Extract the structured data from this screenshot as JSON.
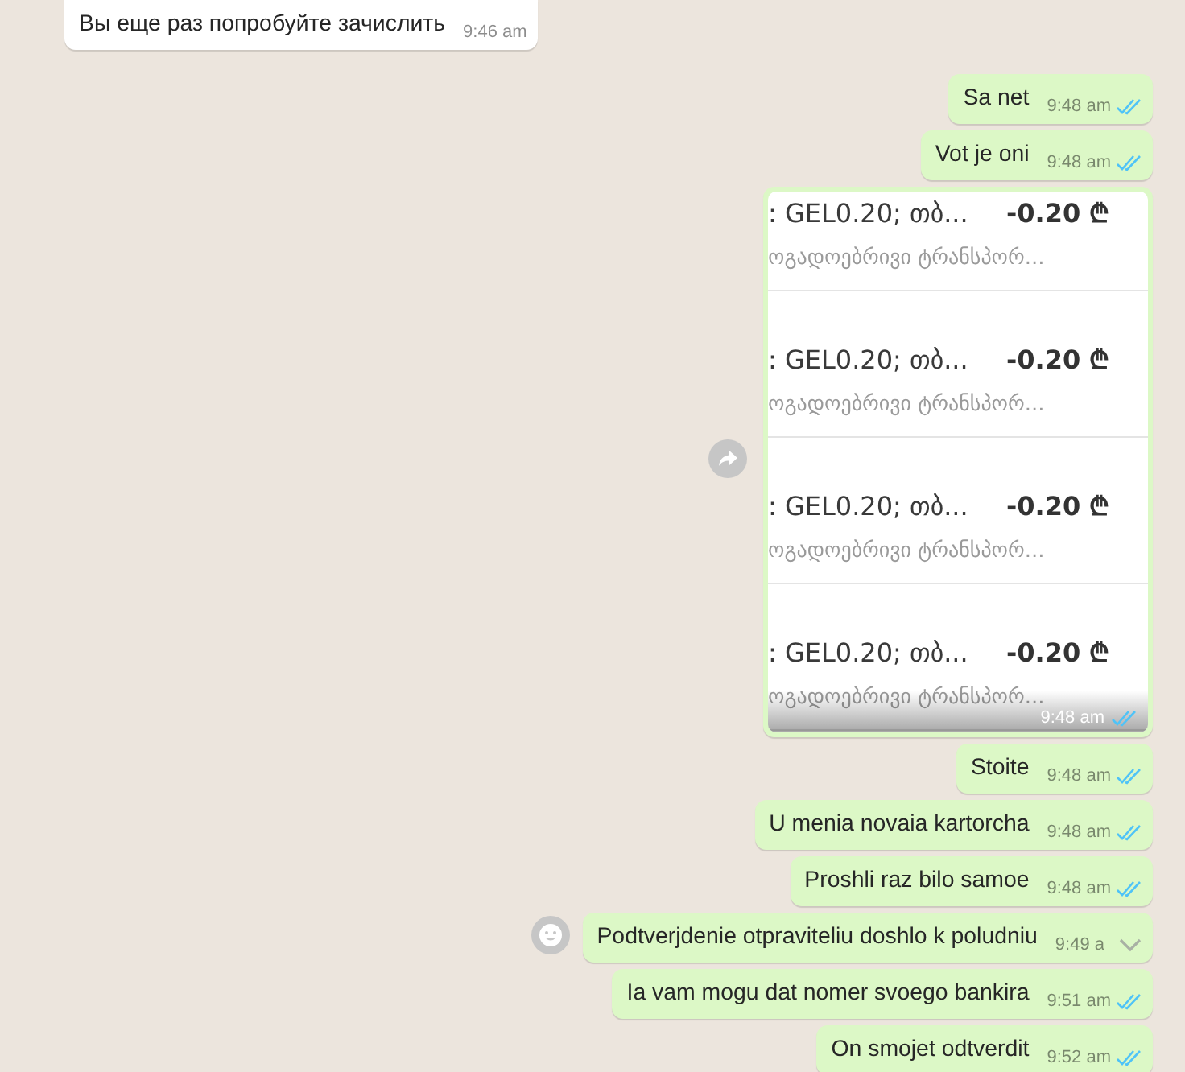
{
  "messages": [
    {
      "kind": "text",
      "outgoing": false,
      "text": "Вы еще раз попробуйте зачислить",
      "time": "9:46 am",
      "hovered": false
    },
    {
      "kind": "text",
      "outgoing": true,
      "text": "Sa net",
      "time": "9:48 am",
      "read": true,
      "hovered": false
    },
    {
      "kind": "text",
      "outgoing": true,
      "text": "Vot je oni",
      "time": "9:48 am",
      "read": true,
      "hovered": false
    },
    {
      "kind": "image",
      "outgoing": true,
      "time": "9:48 am",
      "read": true,
      "transactions": [
        {
          "title": ": GEL0.20; თბ...",
          "amount": "-0.20 ₾",
          "subtitle": "ოგადოებრივი ტრანსპორ..."
        },
        {
          "title": ": GEL0.20; თბ...",
          "amount": "-0.20 ₾",
          "subtitle": "ოგადოებრივი ტრანსპორ..."
        },
        {
          "title": ": GEL0.20; თბ...",
          "amount": "-0.20 ₾",
          "subtitle": "ოგადოებრივი ტრანსპორ..."
        },
        {
          "title": ": GEL0.20; თბ...",
          "amount": "-0.20 ₾",
          "subtitle": "ოგადოებრივი ტრანსპორ..."
        }
      ]
    },
    {
      "kind": "text",
      "outgoing": true,
      "text": "Stoite",
      "time": "9:48 am",
      "read": true,
      "hovered": false
    },
    {
      "kind": "text",
      "outgoing": true,
      "text": "U menia novaia kartorcha",
      "time": "9:48 am",
      "read": true,
      "hovered": false
    },
    {
      "kind": "text",
      "outgoing": true,
      "text": "Proshli raz bilo samoe",
      "time": "9:48 am",
      "read": true,
      "hovered": false
    },
    {
      "kind": "text",
      "outgoing": true,
      "text": "Podtverjdenie otpraviteliu doshlo k poludniu",
      "time": "9:49 a",
      "hovered": true
    },
    {
      "kind": "text",
      "outgoing": true,
      "text": "Ia vam mogu dat nomer svoego bankira",
      "time": "9:51 am",
      "read": true,
      "hovered": false
    },
    {
      "kind": "text",
      "outgoing": true,
      "text": "On smojet odtverdit",
      "time": "9:52 am",
      "read": true,
      "hovered": false
    }
  ]
}
